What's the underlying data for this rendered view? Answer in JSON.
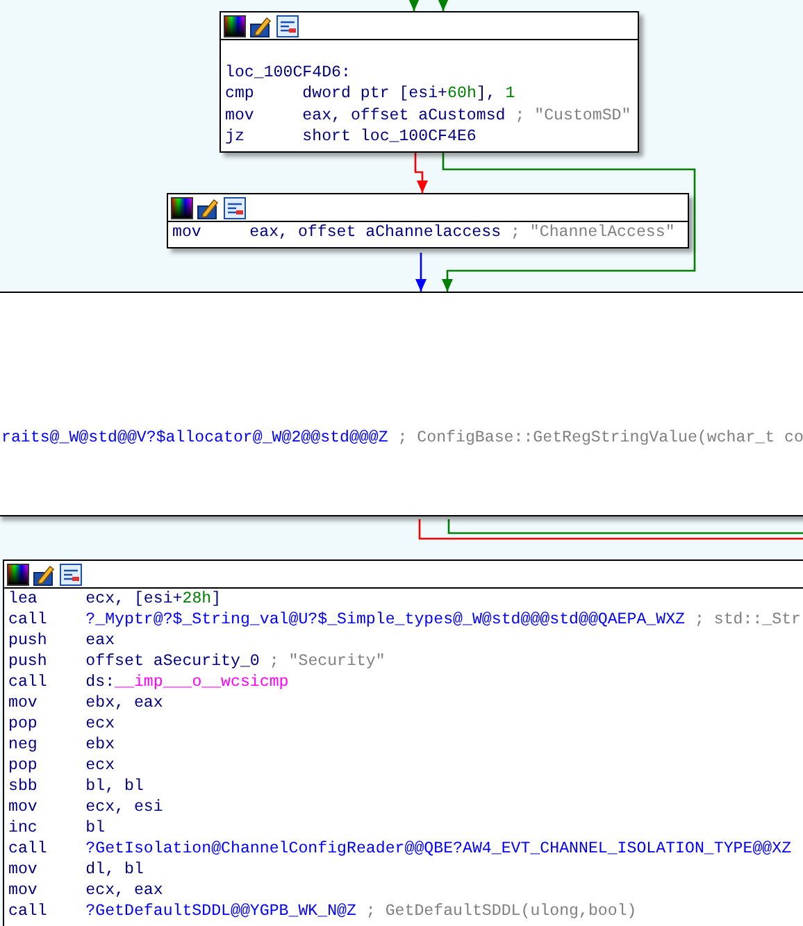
{
  "nodes": [
    {
      "toolbar": true,
      "lines": [
        {
          "kind": "blank"
        },
        {
          "kind": "label",
          "text": "loc_100CF4D6:"
        },
        {
          "kind": "insn",
          "mnemonic": "cmp",
          "operands": [
            {
              "kind": "text",
              "text": "dword ptr [esi+"
            },
            {
              "kind": "number",
              "text": "60h"
            },
            {
              "kind": "text",
              "text": "], "
            },
            {
              "kind": "number",
              "text": "1"
            }
          ]
        },
        {
          "kind": "insn",
          "mnemonic": "mov",
          "operands": [
            {
              "kind": "text",
              "text": "eax, offset aCustomsd "
            },
            {
              "kind": "comment",
              "text": "; \"CustomSD\""
            }
          ]
        },
        {
          "kind": "insn",
          "mnemonic": "jz",
          "operands": [
            {
              "kind": "text",
              "text": "short loc_100CF4E6"
            }
          ]
        }
      ]
    },
    {
      "toolbar": true,
      "lines": [
        {
          "kind": "insn",
          "mnemonic": "mov",
          "operands": [
            {
              "kind": "text",
              "text": "eax, offset aChannelaccess "
            },
            {
              "kind": "comment",
              "text": "; \"ChannelAccess\""
            }
          ]
        }
      ]
    },
    {
      "toolbar": false,
      "lines": [
        {
          "kind": "insn",
          "operands": [
            {
              "kind": "name",
              "text": "raits@_W@std@@V?$allocator@_W@2@@std@@@Z"
            },
            {
              "kind": "comment",
              "text": " ; ConfigBase::GetRegStringValue(wchar_t co"
            }
          ]
        }
      ]
    },
    {
      "toolbar": true,
      "lines": [
        {
          "kind": "insn",
          "mnemonic": "lea",
          "operands": [
            {
              "kind": "text",
              "text": "ecx, [esi+"
            },
            {
              "kind": "number",
              "text": "28h"
            },
            {
              "kind": "text",
              "text": "]"
            }
          ]
        },
        {
          "kind": "insn",
          "mnemonic": "call",
          "operands": [
            {
              "kind": "name",
              "text": "?_Myptr@?$_String_val@U?$_Simple_types@_W@std@@@std@@QAEPA_WXZ"
            },
            {
              "kind": "comment",
              "text": " ; std::_Str"
            }
          ]
        },
        {
          "kind": "insn",
          "mnemonic": "push",
          "operands": [
            {
              "kind": "text",
              "text": "eax"
            }
          ]
        },
        {
          "kind": "insn",
          "mnemonic": "push",
          "operands": [
            {
              "kind": "text",
              "text": "offset aSecurity_0 "
            },
            {
              "kind": "comment",
              "text": "; \"Security\""
            }
          ]
        },
        {
          "kind": "insn",
          "mnemonic": "call",
          "operands": [
            {
              "kind": "text",
              "text": "ds:"
            },
            {
              "kind": "import",
              "text": "__imp___o__wcsicmp"
            }
          ]
        },
        {
          "kind": "insn",
          "mnemonic": "mov",
          "operands": [
            {
              "kind": "text",
              "text": "ebx, eax"
            }
          ]
        },
        {
          "kind": "insn",
          "mnemonic": "pop",
          "operands": [
            {
              "kind": "text",
              "text": "ecx"
            }
          ]
        },
        {
          "kind": "insn",
          "mnemonic": "neg",
          "operands": [
            {
              "kind": "text",
              "text": "ebx"
            }
          ]
        },
        {
          "kind": "insn",
          "mnemonic": "pop",
          "operands": [
            {
              "kind": "text",
              "text": "ecx"
            }
          ]
        },
        {
          "kind": "insn",
          "mnemonic": "sbb",
          "operands": [
            {
              "kind": "text",
              "text": "bl, bl"
            }
          ]
        },
        {
          "kind": "insn",
          "mnemonic": "mov",
          "operands": [
            {
              "kind": "text",
              "text": "ecx, esi"
            }
          ]
        },
        {
          "kind": "insn",
          "mnemonic": "inc",
          "operands": [
            {
              "kind": "text",
              "text": "bl"
            }
          ]
        },
        {
          "kind": "insn",
          "mnemonic": "call",
          "operands": [
            {
              "kind": "name",
              "text": "?GetIsolation@ChannelConfigReader@@QBE?AW4_EVT_CHANNEL_ISOLATION_TYPE@@XZ"
            }
          ]
        },
        {
          "kind": "insn",
          "mnemonic": "mov",
          "operands": [
            {
              "kind": "text",
              "text": "dl, bl"
            }
          ]
        },
        {
          "kind": "insn",
          "mnemonic": "mov",
          "operands": [
            {
              "kind": "text",
              "text": "ecx, eax"
            }
          ]
        },
        {
          "kind": "insn",
          "mnemonic": "call",
          "operands": [
            {
              "kind": "name",
              "text": "?GetDefaultSDDL@@YGPB_WK_N@Z"
            },
            {
              "kind": "comment",
              "text": " ; GetDefaultSDDL(ulong,bool)"
            }
          ]
        }
      ]
    }
  ]
}
